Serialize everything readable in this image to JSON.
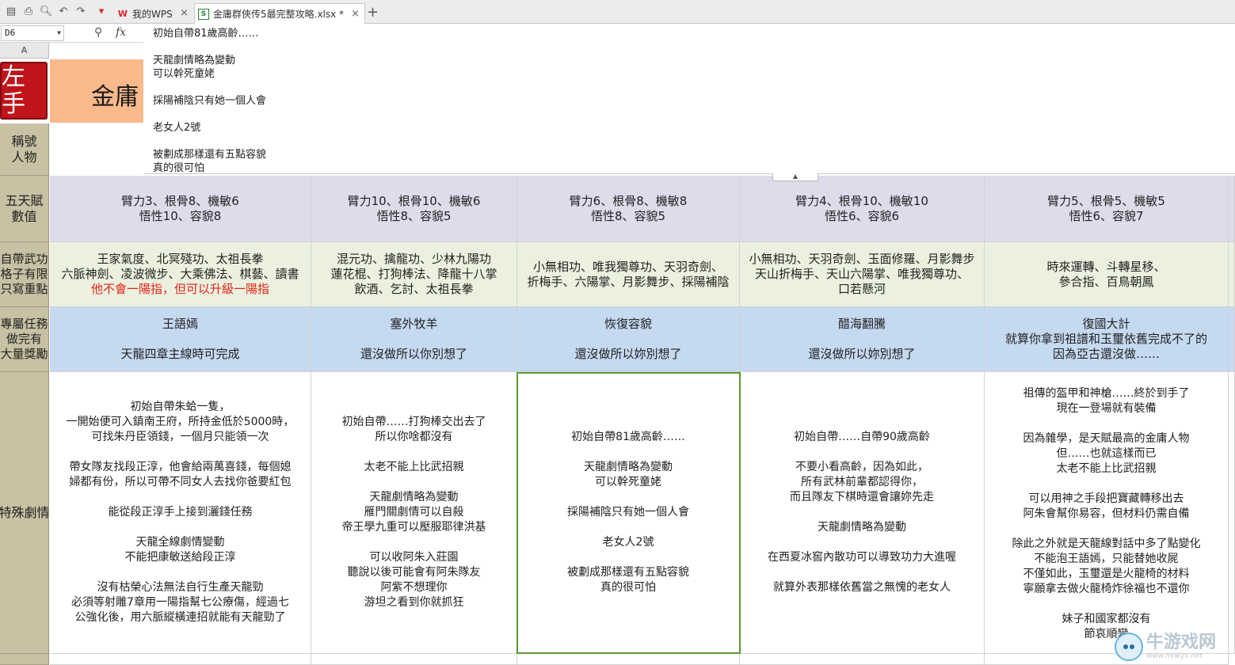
{
  "colors": {
    "talent_row": "#dedbeb",
    "martial_row": "#ebf1de",
    "mission_row": "#c5d9f1",
    "row_header": "#c8c1a3",
    "title_cell": "#f9b98b",
    "logo": "#c0141b",
    "selection": "#5a9a37",
    "red_text": "#e2231a",
    "wps_brand": "#d6242a"
  },
  "tabs": [
    {
      "label": "我的WPS",
      "icon": "wps-logo-icon"
    },
    {
      "label": "金庸群俠传5最完整攻略.xlsx *",
      "icon": "spreadsheet-file-icon"
    }
  ],
  "formula_bar": {
    "cell_ref": "D6",
    "fx": "fx",
    "content": [
      "初始自帶81歲高齡……",
      "天龍劇情略為變動\n可以幹死童姥",
      "採陽補陰只有她一個人會",
      "老女人2號",
      "被劃成那樣還有五點容貌\n真的很可怕"
    ]
  },
  "sheet": {
    "column_header": "A",
    "logo_text": "左手\n花的",
    "title": "金庸",
    "row_labels": {
      "name": "稱號\n人物",
      "talent": "五天賦\n數值",
      "martial": "自帶武功\n格子有限\n只寫重點",
      "mission": "專屬任務\n做完有\n大量獎勵",
      "story": "特殊劇情"
    },
    "talent": [
      "臂力3、根骨8、機敏6\n悟性10、容貌8",
      "臂力10、根骨10、機敏6\n悟性8、容貌5",
      "臂力6、根骨8、機敏8\n悟性8、容貌5",
      "臂力4、根骨10、機敏10\n悟性6、容貌6",
      "臂力5、根骨5、機敏5\n悟性6、容貌7"
    ],
    "martial": [
      {
        "text": "王家氣度、北冥殘功、太祖長拳\n六脈神劍、凌波微步、大乘佛法、棋藝、讀書",
        "red": "他不會一陽指，但可以升級一陽指"
      },
      {
        "text": "混元功、擒龍功、少林九陽功\n蓮花棍、打狗棒法、降龍十八掌\n飲酒、乞討、太祖長拳",
        "red": ""
      },
      {
        "text": "小無相功、唯我獨尊功、天羽奇劍、\n折梅手、六陽掌、月影舞步、採陽補陰",
        "red": ""
      },
      {
        "text": "小無相功、天羽奇劍、玉面修羅、月影舞步\n天山折梅手、天山六陽掌、唯我獨尊功、\n口若懸河",
        "red": ""
      },
      {
        "text": "時來運轉、斗轉星移、\n參合指、百鳥朝鳳",
        "red": ""
      }
    ],
    "mission": [
      "王語嫣\n\n天龍四章主線時可完成",
      "塞外牧羊\n\n還沒做所以你別想了",
      "恢復容貌\n\n還沒做所以妳別想了",
      "醋海翻騰\n\n還沒做所以妳別想了",
      "復國大計\n就算你拿到祖譜和玉璽依舊完成不了的\n因為亞古還沒做……"
    ],
    "story": [
      "初始自帶朱蛤一隻，\n一開始便可入鎮南王府，所持金低於5000時，\n可找朱丹臣領錢，一個月只能領一次\n\n帶女隊友找段正淳，他會給兩萬喜錢，每個媳\n婦都有份，所以可帶不同女人去找你爸要紅包\n\n能從段正淳手上接到灑錢任務\n\n天龍全線劇情變動\n不能把康敏送給段正淳\n\n沒有枯榮心法無法自行生產天龍勁\n必須等射雕7章用一陽指幫七公療傷，經過七\n公強化後，用六脈縱橫連招就能有天龍勁了",
      "初始自帶……打狗棒交出去了\n所以你啥都沒有\n\n太老不能上比武招親\n\n天龍劇情略為變動\n雁門關劇情可以自殺\n帝王學九重可以壓服耶律洪基\n\n可以收阿朱入莊園\n聽說以後可能會有阿朱隊友\n阿紫不想理你\n游坦之看到你就抓狂",
      "初始自帶81歲高齡……\n\n天龍劇情略為變動\n可以幹死童姥\n\n採陽補陰只有她一個人會\n\n老女人2號\n\n被劃成那樣還有五點容貌\n真的很可怕",
      "初始自帶……自帶90歲高齡\n\n不要小看高齡，因為如此，\n所有武林前輩都認得你，\n而且隊友下棋時還會讓妳先走\n\n天龍劇情略為變動\n\n在西夏冰窖內散功可以導致功力大進喔\n\n就算外表那樣依舊當之無愧的老女人",
      "祖傳的盔甲和神槍……終於到手了\n現在一登場就有裝備\n\n因為雜學，是天賦最高的金庸人物\n但……也就這樣而已\n太老不能上比武招親\n\n可以用神之手段把寶藏轉移出去\n阿朱會幫你易容，但材料仍需自備\n\n除此之外就是天龍線對話中多了點變化\n不能泡王語嫣，只能替她收屍\n不僅如此，玉璽還是火龍椅的材料\n寧願拿去做火龍椅炸徐福也不還你\n\n妹子和國家都沒有\n節哀順變"
    ]
  },
  "watermark": {
    "text": "牛游戏网",
    "url": "www.newyx.net"
  }
}
